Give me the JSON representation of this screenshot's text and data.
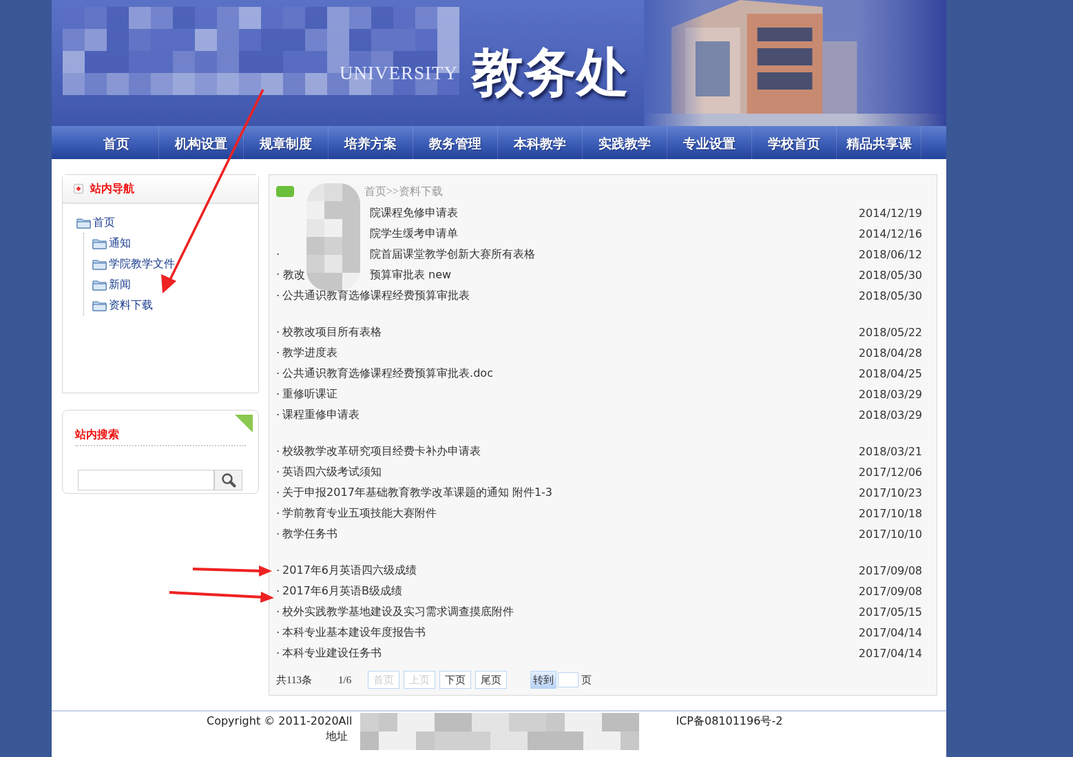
{
  "header": {
    "subtitle": "UNIVERSITY",
    "title": "教务处"
  },
  "nav": [
    {
      "label": "首页"
    },
    {
      "label": "机构设置"
    },
    {
      "label": "规章制度"
    },
    {
      "label": "培养方案"
    },
    {
      "label": "教务管理"
    },
    {
      "label": "本科教学"
    },
    {
      "label": "实践教学"
    },
    {
      "label": "专业设置"
    },
    {
      "label": "学校首页"
    },
    {
      "label": "精品共享课"
    }
  ],
  "site_nav": {
    "title": "站内导航",
    "tree": [
      {
        "label": "首页",
        "children": [
          {
            "label": "通知"
          },
          {
            "label": "学院教学文件"
          },
          {
            "label": "新闻"
          },
          {
            "label": "资料下载"
          }
        ]
      }
    ]
  },
  "site_search": {
    "title": "站内搜索"
  },
  "breadcrumb": "首页>>资料下载",
  "groups": [
    [
      {
        "kind": "redacted",
        "title": "院课程免修申请表",
        "date": "2014/12/19"
      },
      {
        "kind": "redacted",
        "title": "院学生缓考申请单",
        "date": "2014/12/16"
      },
      {
        "kind": "redacted",
        "lead": "·",
        "title": "院首届课堂教学创新大赛所有表格",
        "date": "2018/06/12"
      },
      {
        "kind": "redacted",
        "lead": "· 教改",
        "title": "预算审批表 new",
        "date": "2018/05/30"
      },
      {
        "kind": "plain",
        "lead": "·",
        "title": "公共通识教育选修课程经费预算审批表",
        "date": "2018/05/30"
      }
    ],
    [
      {
        "kind": "plain",
        "lead": "·",
        "title": "校教改项目所有表格",
        "date": "2018/05/22"
      },
      {
        "kind": "plain",
        "lead": "·",
        "title": "教学进度表",
        "date": "2018/04/28"
      },
      {
        "kind": "plain",
        "lead": "·",
        "title": "公共通识教育选修课程经费预算审批表.doc",
        "date": "2018/04/25"
      },
      {
        "kind": "plain",
        "lead": "·",
        "title": "重修听课证",
        "date": "2018/03/29"
      },
      {
        "kind": "plain",
        "lead": "·",
        "title": "课程重修申请表",
        "date": "2018/03/29"
      }
    ],
    [
      {
        "kind": "plain",
        "lead": "·",
        "title": "校级教学改革研究项目经费卡补办申请表",
        "date": "2018/03/21"
      },
      {
        "kind": "plain",
        "lead": "·",
        "title": "英语四六级考试须知",
        "date": "2017/12/06"
      },
      {
        "kind": "plain",
        "lead": "·",
        "title": "关于申报2017年基础教育教学改革课题的通知 附件1-3",
        "date": "2017/10/23"
      },
      {
        "kind": "plain",
        "lead": "·",
        "title": "学前教育专业五项技能大赛附件",
        "date": "2017/10/18"
      },
      {
        "kind": "plain",
        "lead": "·",
        "title": "教学任务书",
        "date": "2017/10/10"
      }
    ],
    [
      {
        "kind": "plain",
        "lead": "·",
        "title": "2017年6月英语四六级成绩",
        "date": "2017/09/08"
      },
      {
        "kind": "plain",
        "lead": "·",
        "title": "2017年6月英语B级成绩",
        "date": "2017/09/08"
      },
      {
        "kind": "plain",
        "lead": "·",
        "title": "校外实践教学基地建设及实习需求调查摸底附件",
        "date": "2017/05/15"
      },
      {
        "kind": "plain",
        "lead": "·",
        "title": "本科专业基本建设年度报告书",
        "date": "2017/04/14"
      },
      {
        "kind": "plain",
        "lead": "·",
        "title": "本科专业建设任务书",
        "date": "2017/04/14"
      }
    ]
  ],
  "pager": {
    "total": "共113条",
    "page": "1/6",
    "buttons": [
      {
        "label": "首页",
        "disabled": true
      },
      {
        "label": "上页",
        "disabled": true
      },
      {
        "label": "下页",
        "disabled": false
      },
      {
        "label": "尾页",
        "disabled": false
      }
    ],
    "goto": "转到",
    "unit": "页"
  },
  "footer": {
    "copyright": "Copyright © 2011-2020All",
    "icp": "ICP备08101196号-2",
    "address": "地址"
  }
}
